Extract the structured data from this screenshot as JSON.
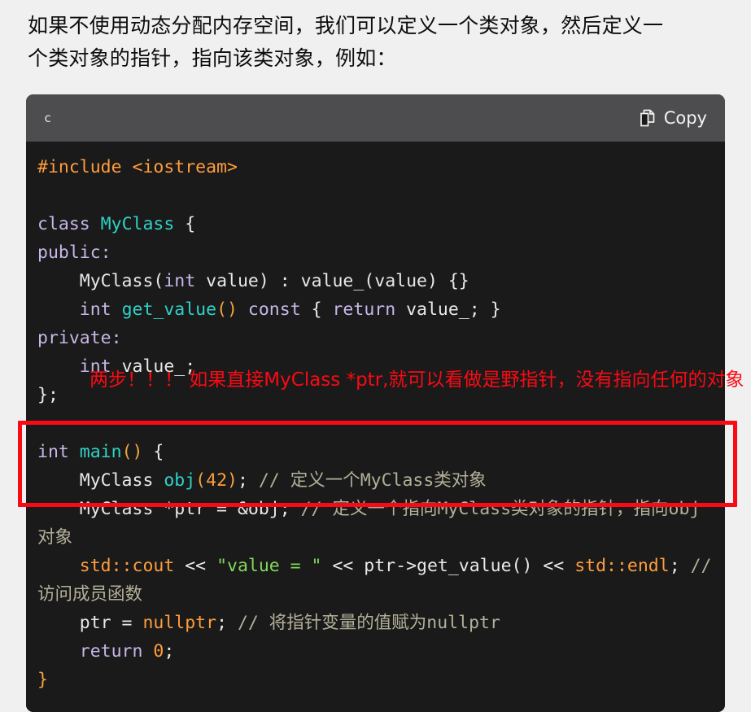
{
  "page": {
    "background_color": "#f0f0f0",
    "intro_paragraph": "如果不使用动态分配内存空间，我们可以定义一个类对象，然后定义一个类对象的指针，指向该类对象，例如："
  },
  "code_block": {
    "language_label": "c",
    "copy_label": "Copy",
    "copy_icon": "copy-icon",
    "header_color": "#4d4d4f",
    "body_color": "#1a1a1a",
    "lines": {
      "l1_include": "#include <iostream>",
      "l2_blank": "",
      "l3_class": "class MyClass {",
      "l4_public": "public:",
      "l5_ctor": "    MyClass(int value) : value_(value) {}",
      "l6_getter": "    int get_value() const { return value_; }",
      "l7_private": "private:",
      "l8_member": "    int value_;",
      "l9_end": "};",
      "l10_blank": "",
      "l11_main": "int main() {",
      "l12_obj": "    MyClass obj(42); // 定义一个MyClass类对象",
      "l13_ptr": "    MyClass *ptr = &obj; // 定义一个指向MyClass类对象的指针，指向obj对象",
      "l14_cout": "    std::cout << \"value = \" << ptr->get_value() << std::endl; // 访问成员函数",
      "l15_null": "    ptr = nullptr; // 将指针变量的值赋为nullptr",
      "l16_return": "    return 0;",
      "l17_close": "}"
    },
    "tokens": {
      "include_directive": "#include",
      "include_header": " <iostream>",
      "kw_class": "class",
      "type_myclass": " MyClass",
      "brace_open": " {",
      "kw_public": "public:",
      "ctor_indent": "    ",
      "ctor_name": "MyClass",
      "ctor_paren_open": "(",
      "kw_int": "int",
      "ctor_param": " value",
      "ctor_paren_close": ")",
      "ctor_init": " : value_(value) {}",
      "getter_indent": "    ",
      "getter_int": "int",
      "getter_name": " get_value",
      "getter_parens": "()",
      "kw_const": " const",
      "getter_body_open": " { ",
      "kw_return": "return",
      "getter_ret_val": " value_; }",
      "kw_private": "private:",
      "member_indent": "    ",
      "member_int": "int",
      "member_name": " value_;",
      "class_end": "};",
      "main_int": "int",
      "main_name": " main",
      "main_parens": "()",
      "main_brace": " {",
      "obj_indent": "    ",
      "obj_type": "MyClass",
      "obj_name": " obj",
      "obj_args_open": "(",
      "obj_num": "42",
      "obj_args_close": ")",
      "obj_semi": ";",
      "obj_comment": " // 定义一个MyClass类对象",
      "ptr_indent": "    ",
      "ptr_type": "MyClass",
      "ptr_decl": " *ptr = &obj;",
      "ptr_comment": " // 定义一个指向MyClass类对象的指针，指向obj对象",
      "cout_indent": "    ",
      "cout_stream": "std::cout",
      "cout_op1": " << ",
      "cout_string": "\"value = \"",
      "cout_op2": " << ptr->get_value() << ",
      "cout_endl": "std::endl",
      "cout_semi": ";",
      "cout_comment": " // 访问成员函数",
      "null_indent": "    ",
      "null_ptr_var": "ptr = ",
      "null_value": "nullptr",
      "null_semi": ";",
      "null_comment": " // 将指针变量的值赋为nullptr",
      "ret_indent": "    ",
      "ret_kw": "return",
      "ret_num": " 0",
      "ret_semi": ";",
      "close_brace": "}"
    },
    "syntax_colors": {
      "preprocessor": "#ff9d3c",
      "keyword": "#c7b7e8",
      "type": "#2fd2c6",
      "string": "#84d65a",
      "number": "#ff9d3c",
      "comment": "#b3b099",
      "plain": "#e8e8e8"
    }
  },
  "annotations": {
    "red_note": "两步！！！ 如果直接MyClass *ptr,就可以看做是野指针，没有指向任何的对象",
    "red_color": "#fa0a14",
    "highlight_box": "red-highlight-box"
  }
}
